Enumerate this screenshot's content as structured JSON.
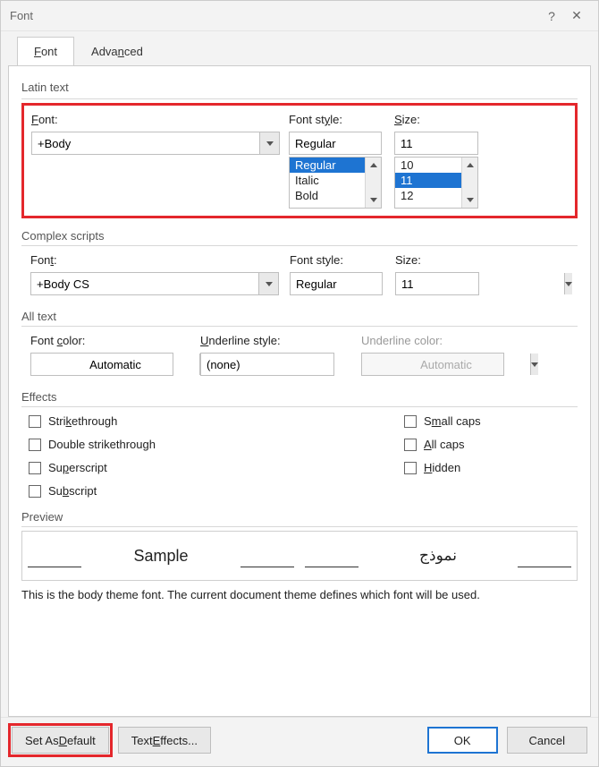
{
  "title": "Font",
  "tabs": {
    "font": "Font",
    "advanced": "Advanced"
  },
  "latin": {
    "group": "Latin text",
    "font_label_pre": "F",
    "font_label_post": "ont:",
    "font_value": "+Body",
    "style_label_pre": "Font st",
    "style_label_u": "y",
    "style_label_post": "le:",
    "style_value": "Regular",
    "style_list": [
      "Regular",
      "Italic",
      "Bold"
    ],
    "style_selected": "Regular",
    "size_label_u": "S",
    "size_label_post": "ize:",
    "size_value": "11",
    "size_list": [
      "10",
      "11",
      "12"
    ],
    "size_selected": "11"
  },
  "complex": {
    "group": "Complex scripts",
    "font_label_pre": "Fon",
    "font_label_u": "t",
    "font_label_post": ":",
    "font_value": "+Body CS",
    "style_label": "Font style:",
    "style_value": "Regular",
    "size_label": "Size:",
    "size_value": "11"
  },
  "alltext": {
    "group": "All text",
    "color_label_pre": "Font ",
    "color_label_u": "c",
    "color_label_post": "olor:",
    "color_value": "Automatic",
    "underline_label_u": "U",
    "underline_label_post": "nderline style:",
    "underline_value": "(none)",
    "ucolor_label": "Underline color:",
    "ucolor_value": "Automatic"
  },
  "effects": {
    "group": "Effects",
    "strike_u": "k",
    "strike_pre": "Stri",
    "strike_post": "ethrough",
    "dstrike": "Double strikethrough",
    "super_pre": "Su",
    "super_u": "p",
    "super_post": "erscript",
    "sub_pre": "Su",
    "sub_u": "b",
    "sub_post": "script",
    "smallcaps_u": "m",
    "smallcaps_pre": "S",
    "smallcaps_post": "all caps",
    "allcaps_u": "A",
    "allcaps_post": "ll caps",
    "hidden_pre": "",
    "hidden_u": "H",
    "hidden_post": "idden"
  },
  "preview": {
    "group": "Preview",
    "sample": "Sample",
    "sample_ar": "نموذج",
    "note": "This is the body theme font. The current document theme defines which font will be used."
  },
  "footer": {
    "set_default_pre": "Set As ",
    "set_default_u": "D",
    "set_default_post": "efault",
    "text_effects_pre": "Text ",
    "text_effects_u": "E",
    "text_effects_post": "ffects...",
    "ok": "OK",
    "cancel": "Cancel"
  }
}
